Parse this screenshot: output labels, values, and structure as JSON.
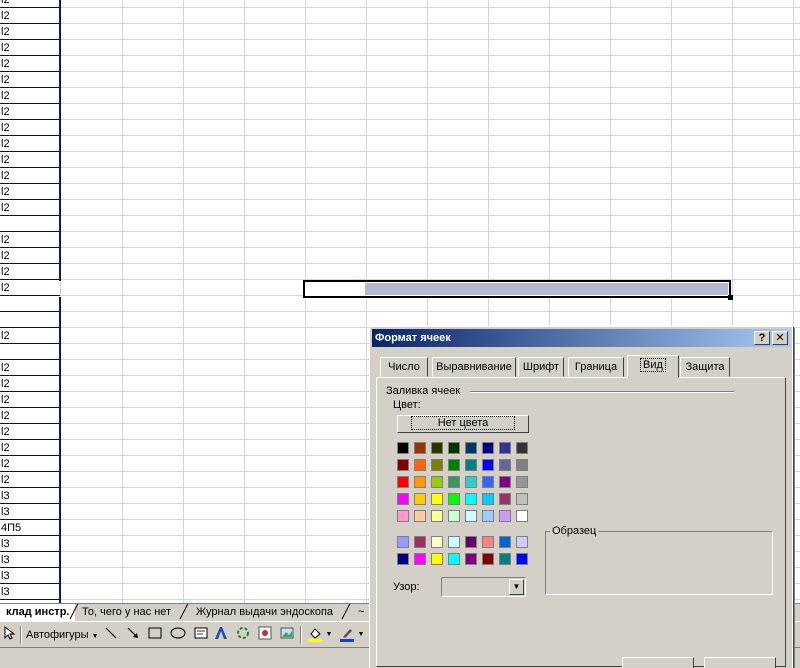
{
  "sheet": {
    "column_a_labels": [
      "l2",
      "l2",
      "l2",
      "l2",
      "l2",
      "l2",
      "l2",
      "l2",
      "l2",
      "l2",
      "l2",
      "l2",
      "l2",
      "l2",
      "",
      "l2",
      "l2",
      "l2",
      "l2",
      "",
      "",
      "l2",
      "",
      "l2",
      "l2",
      "l2",
      "l2",
      "l2",
      "l2",
      "l2",
      "l2",
      "l3",
      "l3",
      "4П5",
      "l3",
      "l3",
      "l3",
      "l3"
    ]
  },
  "sheet_tabs": {
    "active": "клад инстр.",
    "tab2": "То, чего у нас нет",
    "tab3": "Журнал выдачи эндоскопа",
    "tab4": "~"
  },
  "draw_toolbar": {
    "autoshapes": "Автофигуры"
  },
  "dialog": {
    "title": "Формат ячеек",
    "help_glyph": "?",
    "close_glyph": "✕",
    "tabs": [
      "Число",
      "Выравнивание",
      "Шрифт",
      "Граница",
      "Вид",
      "Защита"
    ],
    "active_tab": "Вид",
    "fill_group": "Заливка ячеек",
    "color_label": "Цвет:",
    "no_color": "Нет цвета",
    "pattern_label": "Узор:",
    "sample_label": "Образец",
    "palette_main": [
      [
        "#000000",
        "#993300",
        "#333300",
        "#003300",
        "#003366",
        "#000080",
        "#333399",
        "#333333"
      ],
      [
        "#800000",
        "#ff6600",
        "#808000",
        "#008000",
        "#008080",
        "#0000ff",
        "#666699",
        "#808080"
      ],
      [
        "#ff0000",
        "#ff9900",
        "#99cc00",
        "#339966",
        "#33cccc",
        "#3366ff",
        "#800080",
        "#969696"
      ],
      [
        "#ff00ff",
        "#ffcc00",
        "#ffff00",
        "#00ff00",
        "#00ffff",
        "#00ccff",
        "#993366",
        "#c0c0c0"
      ],
      [
        "#ff99cc",
        "#ffcc99",
        "#ffff99",
        "#ccffcc",
        "#ccffff",
        "#99ccff",
        "#cc99ff",
        "#ffffff"
      ]
    ],
    "palette_chart": [
      [
        "#9999ff",
        "#993366",
        "#ffffcc",
        "#ccffff",
        "#660066",
        "#ff8080",
        "#0066cc",
        "#ccccff"
      ],
      [
        "#000080",
        "#ff00ff",
        "#ffff00",
        "#00ffff",
        "#800080",
        "#800000",
        "#008080",
        "#0000ff"
      ]
    ]
  }
}
